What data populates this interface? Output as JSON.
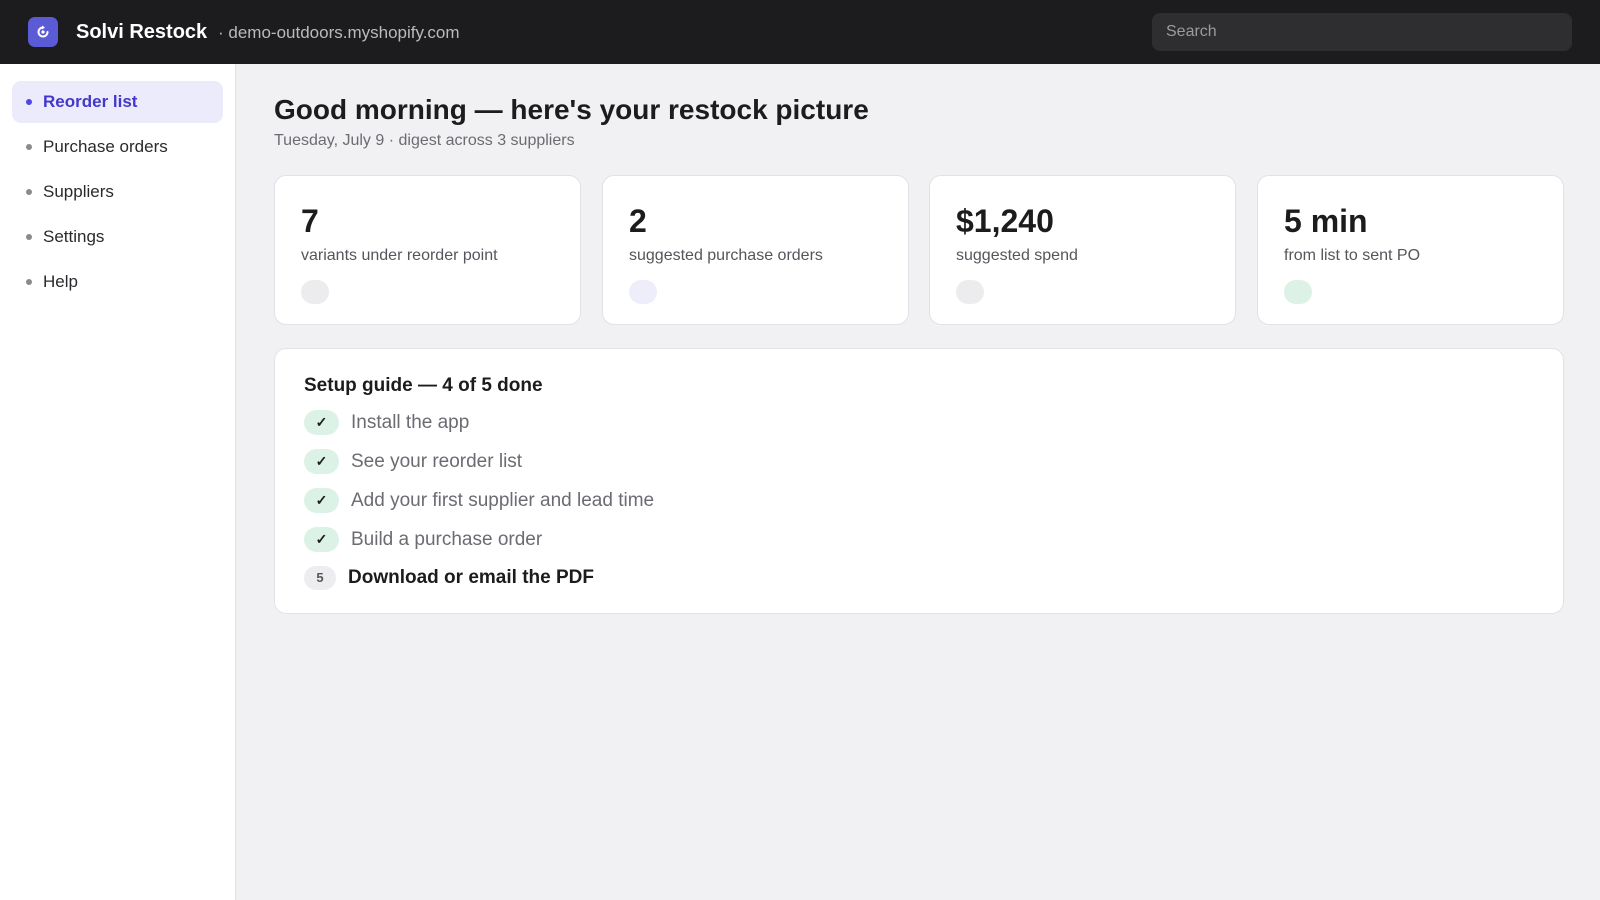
{
  "header": {
    "app_name": "Solvi Restock",
    "store": "· demo-outdoors.myshopify.com",
    "search_placeholder": "Search",
    "logo_icon": "restock-logo-icon",
    "brand_color": "#5b5bd6"
  },
  "sidebar": {
    "items": [
      {
        "label": "Reorder list",
        "active": true
      },
      {
        "label": "Purchase orders",
        "active": false
      },
      {
        "label": "Suppliers",
        "active": false
      },
      {
        "label": "Settings",
        "active": false
      },
      {
        "label": "Help",
        "active": false
      }
    ]
  },
  "main": {
    "title": "Good morning — here's your restock picture",
    "subtitle": "Tuesday, July 9 · digest across 3 suppliers",
    "stats": [
      {
        "value": "7",
        "label": "variants under reorder point",
        "badge_color": "#ececee"
      },
      {
        "value": "2",
        "label": "suggested purchase orders",
        "badge_color": "#eeeefb"
      },
      {
        "value": "$1,240",
        "label": "suggested spend",
        "badge_color": "#ececee"
      },
      {
        "value": "5 min",
        "label": "from list to sent PO",
        "badge_color": "#dcf2e6"
      }
    ],
    "setup_guide": {
      "title": "Setup guide — 4 of 5 done",
      "steps": [
        {
          "marker": "✓",
          "label": "Install the app",
          "done": true
        },
        {
          "marker": "✓",
          "label": "See your reorder list",
          "done": true
        },
        {
          "marker": "✓",
          "label": "Add your first supplier and lead time",
          "done": true
        },
        {
          "marker": "✓",
          "label": "Build a purchase order",
          "done": true
        },
        {
          "marker": "5",
          "label": "Download or email the PDF",
          "done": false
        }
      ]
    }
  }
}
